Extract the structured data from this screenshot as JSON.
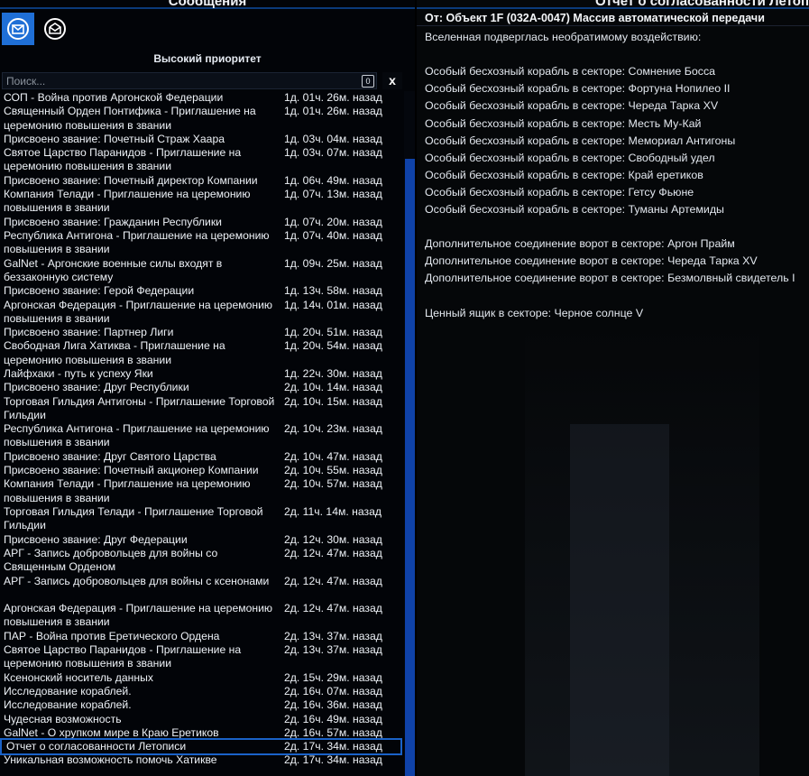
{
  "left_panel": {
    "title": "Сообщения",
    "tabs": [
      {
        "name": "inbox",
        "icon": "inbox-mail-icon",
        "active": true
      },
      {
        "name": "read",
        "icon": "open-envelope-icon",
        "active": false
      }
    ],
    "priority_label": "Высокий приоритет",
    "search": {
      "placeholder": "Поиск...",
      "value": "",
      "count": "0",
      "clear_label": "x"
    },
    "messages": [
      {
        "title": "СОП - Война против Аргонской Федерации",
        "time": "1д. 01ч. 26м. назад"
      },
      {
        "title": "Священный Орден Понтифика - Приглашение на церемонию повышения в звании",
        "time": "1д. 01ч. 26м. назад"
      },
      {
        "title": "Присвоено звание: Почетный Страж Хаара",
        "time": "1д. 03ч. 04м. назад"
      },
      {
        "title": "Святое Царство Паранидов - Приглашение на церемонию повышения в звании",
        "time": "1д. 03ч. 07м. назад"
      },
      {
        "title": "Присвоено звание: Почетный директор Компании",
        "time": "1д. 06ч. 49м. назад"
      },
      {
        "title": "Компания Телади - Приглашение на церемонию повышения в звании",
        "time": "1д. 07ч. 13м. назад"
      },
      {
        "title": "Присвоено звание: Гражданин Республики",
        "time": "1д. 07ч. 20м. назад"
      },
      {
        "title": "Республика Антигона - Приглашение на церемонию повышения в звании",
        "time": "1д. 07ч. 40м. назад"
      },
      {
        "title": "GalNet - Аргонские военные силы входят в беззаконную систему",
        "time": "1д. 09ч. 25м. назад"
      },
      {
        "title": "Присвоено звание: Герой Федерации",
        "time": "1д. 13ч. 58м. назад"
      },
      {
        "title": "Аргонская Федерация - Приглашение на церемонию повышения в звании",
        "time": "1д. 14ч. 01м. назад"
      },
      {
        "title": "Присвоено звание: Партнер Лиги",
        "time": "1д. 20ч. 51м. назад"
      },
      {
        "title": "Свободная Лига Хатиква - Приглашение на церемонию повышения в звании",
        "time": "1д. 20ч. 54м. назад"
      },
      {
        "title": "Лайфхаки - путь к успеху Яки",
        "time": "1д. 22ч. 30м. назад"
      },
      {
        "title": "Присвоено звание: Друг Республики",
        "time": "2д. 10ч. 14м. назад"
      },
      {
        "title": "Торговая Гильдия Антигоны - Приглашение Торговой Гильдии",
        "time": "2д. 10ч. 15м. назад"
      },
      {
        "title": "Республика Антигона - Приглашение на церемонию повышения в звании",
        "time": "2д. 10ч. 23м. назад"
      },
      {
        "title": "Присвоено звание: Друг Святого Царства",
        "time": "2д. 10ч. 47м. назад"
      },
      {
        "title": "Присвоено звание: Почетный акционер Компании",
        "time": "2д. 10ч. 55м. назад"
      },
      {
        "title": "Компания Телади - Приглашение на церемонию повышения в звании",
        "time": "2д. 10ч. 57м. назад"
      },
      {
        "title": "Торговая Гильдия Телади - Приглашение Торговой Гильдии",
        "time": "2д. 11ч. 14м. назад"
      },
      {
        "title": "Присвоено звание: Друг Федерации",
        "time": "2д. 12ч. 30м. назад"
      },
      {
        "title": "АРГ - Запись добровольцев для войны со Священным Орденом",
        "time": "2д. 12ч. 47м. назад"
      },
      {
        "title": "АРГ - Запись добровольцев для войны с ксенонами",
        "time": "2д. 12ч. 47м. назад"
      },
      {
        "title": "Аргонская Федерация - Приглашение на церемонию повышения в звании",
        "time": "2д. 12ч. 47м. назад"
      },
      {
        "title": "ПАР - Война против Еретического Ордена",
        "time": "2д. 13ч. 37м. назад"
      },
      {
        "title": "Святое Царство Паранидов - Приглашение на церемонию повышения в звании",
        "time": "2д. 13ч. 37м. назад"
      },
      {
        "title": "Ксенонский носитель данных",
        "time": "2д. 15ч. 29м. назад"
      },
      {
        "title": "Исследование кораблей.",
        "time": "2д. 16ч. 07м. назад"
      },
      {
        "title": "Исследование кораблей.",
        "time": "2д. 16ч. 36м. назад"
      },
      {
        "title": "Чудесная возможность",
        "time": "2д. 16ч. 49м. назад"
      },
      {
        "title": "GalNet - О хрупком мире в Краю Еретиков",
        "time": "2д. 16ч. 57м. назад"
      },
      {
        "title": "Отчет о согласованности Летописи",
        "time": "2д. 17ч. 34м. назад",
        "selected": true
      },
      {
        "title": "Уникальная возможность помочь Хатикве",
        "time": "2д. 17ч. 34м. назад"
      }
    ]
  },
  "detail": {
    "title": "Отчет о согласованности Летописи",
    "from": "От: Объект 1F (032A-0047) Массив автоматической передачи",
    "lines": [
      "Вселенная подверглась необратимому воздействию:",
      "",
      "Особый бесхозный корабль в секторе: Сомнение Босса",
      "Особый бесхозный корабль в секторе: Фортуна Нопилео II",
      "Особый бесхозный корабль в секторе: Череда Тарка XV",
      "Особый бесхозный корабль в секторе: Месть Му-Кай",
      "Особый бесхозный корабль в секторе: Мемориал Антигоны",
      "Особый бесхозный корабль в секторе: Свободный удел",
      "Особый бесхозный корабль в секторе: Край еретиков",
      "Особый бесхозный корабль в секторе: Гетсу Фьюне",
      "Особый бесхозный корабль в секторе: Туманы Артемиды",
      "",
      "Дополнительное соединение ворот в секторе: Аргон Прайм",
      "Дополнительное соединение ворот в секторе: Череда Тарка XV",
      "Дополнительное соединение ворот в секторе: Безмолвный свидетель I",
      "",
      "Ценный ящик в секторе: Черное солнце V"
    ]
  },
  "colors": {
    "accent": "#1f6fd6",
    "scrollbar": "#0f42a8",
    "selected_outline": "#1a62c8",
    "panel_line": "#0b3a7a"
  }
}
